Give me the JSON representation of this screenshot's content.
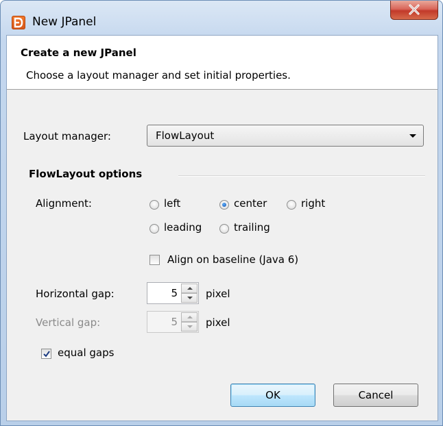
{
  "window": {
    "title": "New JPanel",
    "app_icon": "app-logo-icon",
    "close_icon": "close-icon"
  },
  "header": {
    "title": "Create a new JPanel",
    "subtitle": "Choose a layout manager and set initial properties."
  },
  "layout_manager": {
    "label": "Layout manager:",
    "selected": "FlowLayout"
  },
  "options": {
    "section_title": "FlowLayout options",
    "alignment_label": "Alignment:",
    "alignment_choices": [
      {
        "label": "left",
        "selected": false
      },
      {
        "label": "center",
        "selected": true
      },
      {
        "label": "right",
        "selected": false
      },
      {
        "label": "leading",
        "selected": false
      },
      {
        "label": "trailing",
        "selected": false
      }
    ],
    "align_baseline": {
      "label": "Align on baseline (Java 6)",
      "checked": false
    },
    "horizontal_gap": {
      "label": "Horizontal gap:",
      "value": "5",
      "unit": "pixel",
      "enabled": true
    },
    "vertical_gap": {
      "label": "Vertical gap:",
      "value": "5",
      "unit": "pixel",
      "enabled": false
    },
    "equal_gaps": {
      "label": "equal gaps",
      "checked": true
    }
  },
  "buttons": {
    "ok": "OK",
    "cancel": "Cancel"
  },
  "colors": {
    "accent": "#3c7fb1",
    "close_button": "#c2392a"
  }
}
